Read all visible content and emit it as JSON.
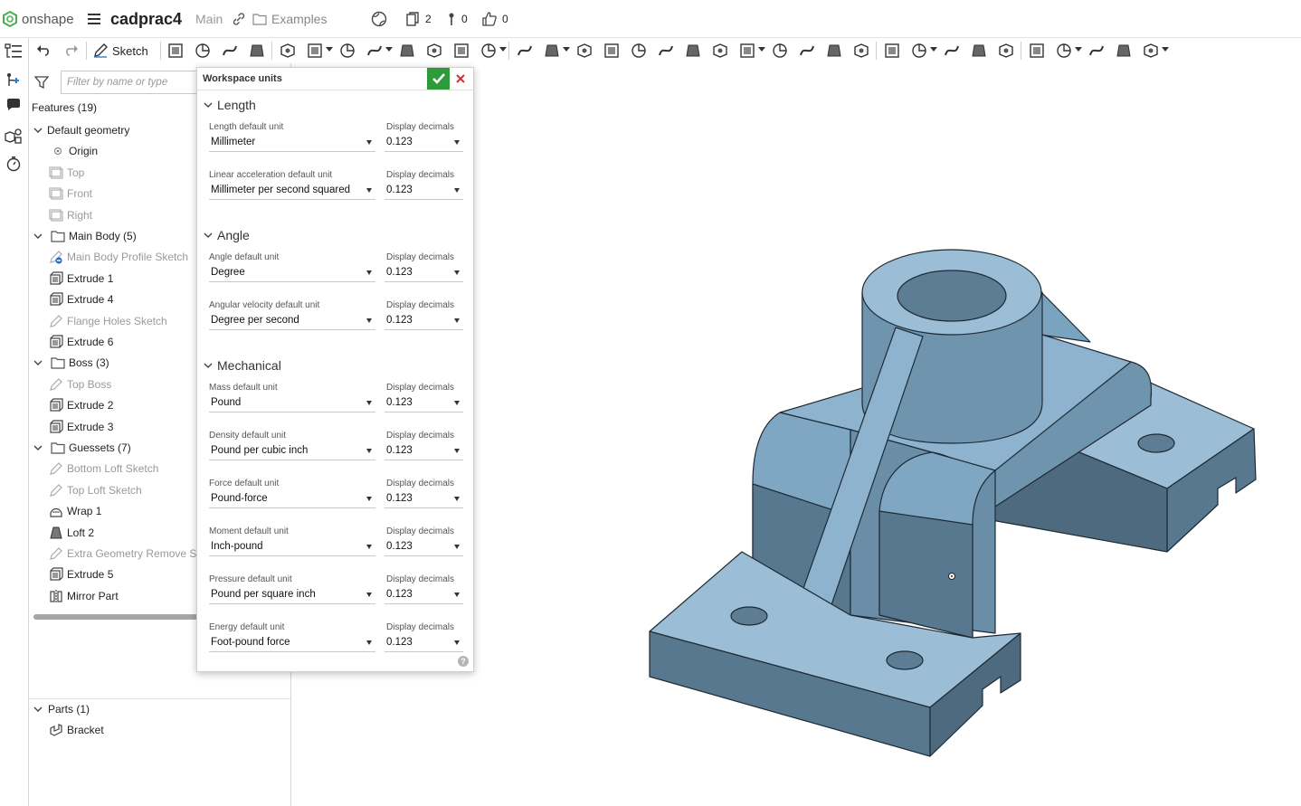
{
  "app": {
    "brand": "onshape",
    "doc_title": "cadprac4",
    "branch": "Main",
    "folder": "Examples",
    "versions_count": "2",
    "branches_count": "0",
    "likes_count": "0"
  },
  "toolbar": {
    "sketch_label": "Sketch"
  },
  "feature_panel": {
    "filter_placeholder": "Filter by name or type",
    "features_header": "Features (19)",
    "tree": [
      {
        "label": "Default geometry",
        "kind": "group",
        "depth": 0,
        "dim": false
      },
      {
        "label": "Origin",
        "kind": "origin",
        "depth": 1,
        "dim": false
      },
      {
        "label": "Top",
        "kind": "plane",
        "depth": 1,
        "dim": true
      },
      {
        "label": "Front",
        "kind": "plane",
        "depth": 1,
        "dim": true
      },
      {
        "label": "Right",
        "kind": "plane",
        "depth": 1,
        "dim": true
      },
      {
        "label": "Main Body (5)",
        "kind": "folder",
        "depth": 0,
        "dim": false
      },
      {
        "label": "Main Body Profile Sketch",
        "kind": "sketch-error",
        "depth": 1,
        "dim": true
      },
      {
        "label": "Extrude 1",
        "kind": "extrude",
        "depth": 1,
        "dim": false
      },
      {
        "label": "Extrude 4",
        "kind": "extrude",
        "depth": 1,
        "dim": false
      },
      {
        "label": "Flange Holes Sketch",
        "kind": "sketch",
        "depth": 1,
        "dim": true
      },
      {
        "label": "Extrude 6",
        "kind": "extrude",
        "depth": 1,
        "dim": false
      },
      {
        "label": "Boss (3)",
        "kind": "folder",
        "depth": 0,
        "dim": false
      },
      {
        "label": "Top Boss",
        "kind": "sketch",
        "depth": 1,
        "dim": true
      },
      {
        "label": "Extrude 2",
        "kind": "extrude",
        "depth": 1,
        "dim": false
      },
      {
        "label": "Extrude 3",
        "kind": "extrude",
        "depth": 1,
        "dim": false
      },
      {
        "label": "Guessets (7)",
        "kind": "folder",
        "depth": 0,
        "dim": false
      },
      {
        "label": "Bottom Loft Sketch",
        "kind": "sketch",
        "depth": 1,
        "dim": true
      },
      {
        "label": "Top Loft Sketch",
        "kind": "sketch",
        "depth": 1,
        "dim": true
      },
      {
        "label": "Wrap 1",
        "kind": "wrap",
        "depth": 1,
        "dim": false
      },
      {
        "label": "Loft 2",
        "kind": "loft",
        "depth": 1,
        "dim": false
      },
      {
        "label": "Extra Geometry Remove Sk",
        "kind": "sketch",
        "depth": 1,
        "dim": true
      },
      {
        "label": "Extrude 5",
        "kind": "extrude",
        "depth": 1,
        "dim": false
      },
      {
        "label": "Mirror Part",
        "kind": "mirror",
        "depth": 1,
        "dim": false
      }
    ],
    "parts_header": "Parts (1)",
    "parts": [
      "Bracket"
    ]
  },
  "dialog": {
    "title": "Workspace units",
    "sections": [
      {
        "title": "Length",
        "fields": [
          {
            "label": "Length default unit",
            "value": "Millimeter",
            "decimals_label": "Display decimals",
            "decimals": "0.123"
          },
          {
            "label": "Linear acceleration default unit",
            "value": "Millimeter per second squared",
            "decimals_label": "Display decimals",
            "decimals": "0.123"
          }
        ]
      },
      {
        "title": "Angle",
        "fields": [
          {
            "label": "Angle default unit",
            "value": "Degree",
            "decimals_label": "Display decimals",
            "decimals": "0.123"
          },
          {
            "label": "Angular velocity default unit",
            "value": "Degree per second",
            "decimals_label": "Display decimals",
            "decimals": "0.123"
          }
        ]
      },
      {
        "title": "Mechanical",
        "fields": [
          {
            "label": "Mass default unit",
            "value": "Pound",
            "decimals_label": "Display decimals",
            "decimals": "0.123"
          },
          {
            "label": "Density default unit",
            "value": "Pound per cubic inch",
            "decimals_label": "Display decimals",
            "decimals": "0.123"
          },
          {
            "label": "Force default unit",
            "value": "Pound-force",
            "decimals_label": "Display decimals",
            "decimals": "0.123"
          },
          {
            "label": "Moment default unit",
            "value": "Inch-pound",
            "decimals_label": "Display decimals",
            "decimals": "0.123"
          },
          {
            "label": "Pressure default unit",
            "value": "Pound per square inch",
            "decimals_label": "Display decimals",
            "decimals": "0.123"
          },
          {
            "label": "Energy default unit",
            "value": "Foot-pound force",
            "decimals_label": "Display decimals",
            "decimals": "0.123"
          }
        ]
      }
    ]
  },
  "colors": {
    "accept_green": "#2e9a3a",
    "cancel_red": "#d23030",
    "part_face": "#7fa7c4",
    "part_face_dark": "#58788f",
    "part_face_light": "#9bbdd6",
    "part_edge": "#1e2a33"
  }
}
